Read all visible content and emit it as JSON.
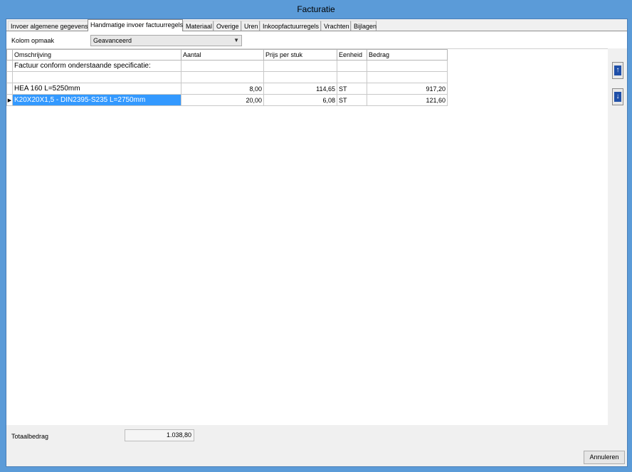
{
  "window": {
    "title": "Facturatie"
  },
  "tabs": [
    {
      "label": "Invoer algemene gegevens",
      "active": false
    },
    {
      "label": "Handmatige invoer factuurregels",
      "active": true
    },
    {
      "label": "Materiaal",
      "active": false
    },
    {
      "label": "Overige",
      "active": false
    },
    {
      "label": "Uren",
      "active": false
    },
    {
      "label": "Inkoopfactuurregels",
      "active": false
    },
    {
      "label": "Vrachten",
      "active": false
    },
    {
      "label": "Bijlagen",
      "active": false
    }
  ],
  "kolom": {
    "label": "Kolom opmaak",
    "value": "Geavanceerd"
  },
  "grid": {
    "columns": [
      "Omschrijving",
      "Aantal",
      "Prijs per stuk",
      "Eenheid",
      "Bedrag"
    ],
    "rows": [
      {
        "omschrijving": "Factuur conform onderstaande specificatie:",
        "aantal": "",
        "prijs": "",
        "eenheid": "",
        "bedrag": ""
      },
      {
        "omschrijving": "",
        "aantal": "",
        "prijs": "",
        "eenheid": "",
        "bedrag": ""
      },
      {
        "omschrijving": "HEA  160 L=5250mm",
        "aantal": "8,00",
        "prijs": "114,65",
        "eenheid": "ST",
        "bedrag": "917,20"
      },
      {
        "omschrijving": "K20X20X1,5 - DIN2395-S235 L=2750mm",
        "aantal": "20,00",
        "prijs": "6,08",
        "eenheid": "ST",
        "bedrag": "121,60"
      }
    ],
    "selected_row": 3
  },
  "side_buttons": {
    "up_icon": "arrow-up-icon",
    "down_icon": "arrow-down-icon"
  },
  "footer": {
    "total_label": "Totaalbedrag",
    "total_value": "1.038,80",
    "cancel_label": "Annuleren"
  },
  "colors": {
    "title_bar": "#5b9bd8",
    "selection": "#3399ff",
    "arrow_blue": "#1f4fa8"
  }
}
